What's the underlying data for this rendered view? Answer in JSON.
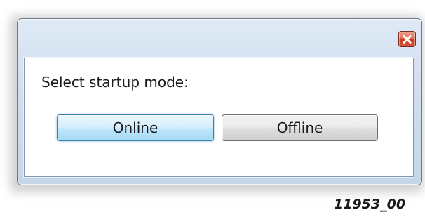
{
  "dialog": {
    "title": "",
    "prompt": "Select startup mode:",
    "buttons": {
      "online_label": "Online",
      "offline_label": "Offline"
    },
    "close_icon": "close-icon"
  },
  "figure_label": "11953_00",
  "colors": {
    "close_button": "#d8583c",
    "default_button_border": "#3c7fb1",
    "titlebar": "#cfdcec"
  }
}
